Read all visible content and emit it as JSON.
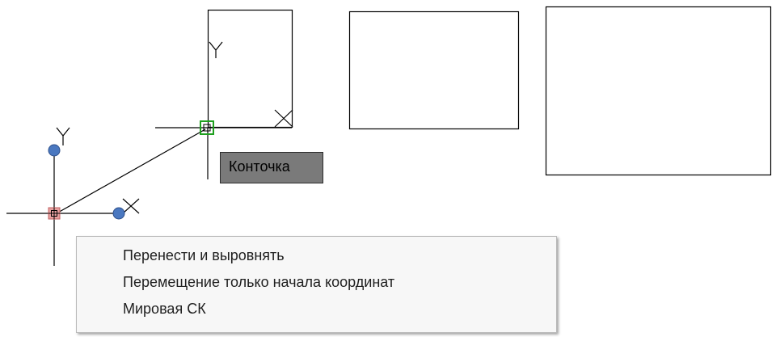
{
  "tooltip": {
    "text": "Конточка"
  },
  "context_menu": {
    "items": [
      {
        "label": "Перенести и выровнять"
      },
      {
        "label": "Перемещение только начала координат"
      },
      {
        "label": "Мировая СК"
      }
    ]
  },
  "colors": {
    "background": "#ffffff",
    "drawing_lines": "#000000",
    "grip_blue": "#4a78c0",
    "grip_red": "#e8a0a0",
    "snap_marker_green": "#1fa01f",
    "tooltip_bg": "#7a7a7a",
    "menu_bg": "#f7f7f7"
  },
  "icons": [
    "ucs-origin-grip-icon",
    "ucs-x-axis-grip-icon",
    "ucs-y-axis-grip-icon",
    "endpoint-snap-marker-icon"
  ]
}
